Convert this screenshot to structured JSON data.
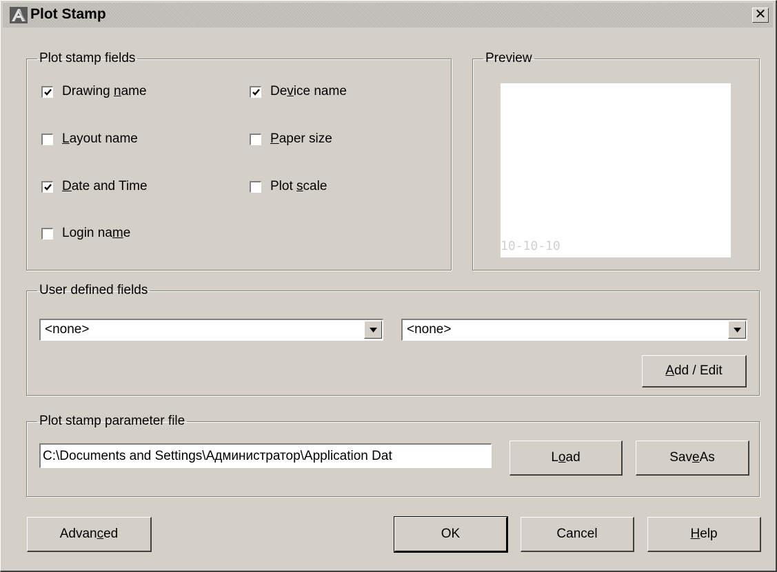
{
  "window": {
    "title": "Plot Stamp",
    "app_icon": "autocad-icon",
    "close_glyph": "✕"
  },
  "plot_stamp_fields": {
    "legend": "Plot stamp fields",
    "checkboxes": [
      {
        "label_pre": "Drawing ",
        "mnemonic": "n",
        "label_post": "ame",
        "checked": true
      },
      {
        "label_pre": "De",
        "mnemonic": "v",
        "label_post": "ice name",
        "checked": true
      },
      {
        "label_pre": "",
        "mnemonic": "L",
        "label_post": "ayout name",
        "checked": false
      },
      {
        "label_pre": "",
        "mnemonic": "P",
        "label_post": "aper size",
        "checked": false
      },
      {
        "label_pre": "",
        "mnemonic": "D",
        "label_post": "ate and Time",
        "checked": true
      },
      {
        "label_pre": "Plot ",
        "mnemonic": "s",
        "label_post": "cale",
        "checked": false
      },
      {
        "label_pre": "Login na",
        "mnemonic": "m",
        "label_post": "e",
        "checked": false
      }
    ]
  },
  "preview": {
    "legend": "Preview",
    "sample_text": "10-10-10"
  },
  "user_defined_fields": {
    "legend": "User defined fields",
    "combo1_value": "<none>",
    "combo2_value": "<none>",
    "add_edit_pre": "",
    "add_edit_mnemonic": "A",
    "add_edit_post": "dd / Edit"
  },
  "parameter_file": {
    "legend": "Plot stamp parameter file",
    "path_value": "C:\\Documents and Settings\\Администратор\\Application Dat",
    "load_pre": "L",
    "load_mnemonic": "o",
    "load_post": "ad",
    "save_as_pre": "Sav",
    "save_as_mnemonic": "e",
    "save_as_post": " As"
  },
  "footer": {
    "advanced_pre": "Advan",
    "advanced_mnemonic": "c",
    "advanced_post": "ed",
    "ok_label": "OK",
    "cancel_label": "Cancel",
    "help_pre": "",
    "help_mnemonic": "H",
    "help_post": "elp"
  }
}
